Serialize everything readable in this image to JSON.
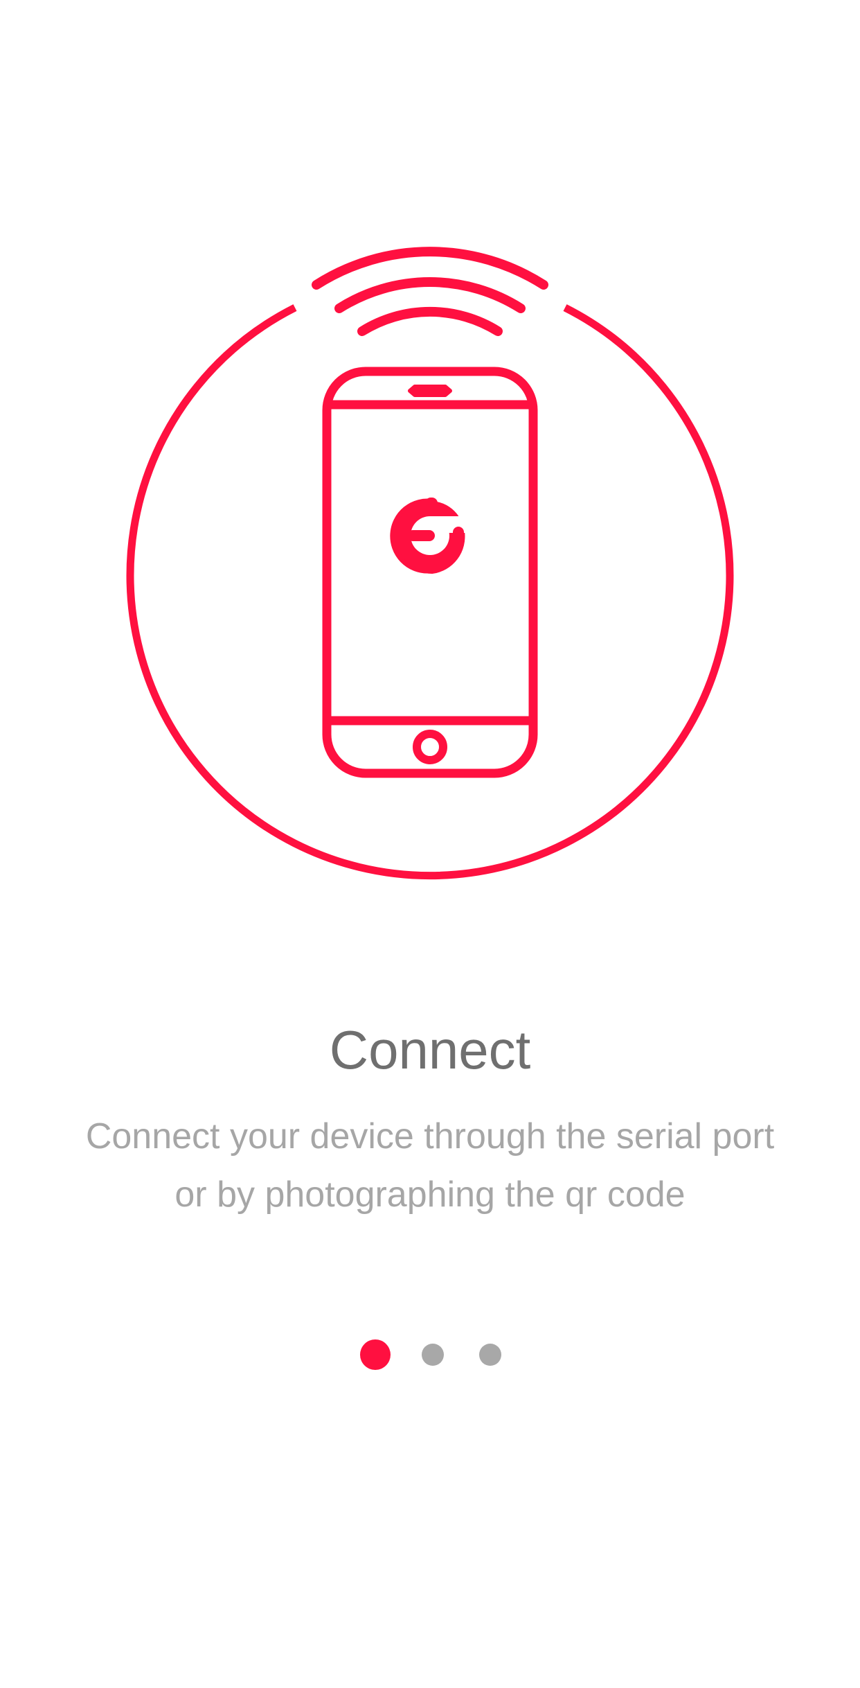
{
  "colors": {
    "accent": "#ff1040",
    "title": "#6f6f6f",
    "description": "#a6a6a6",
    "dot_inactive": "#a8a8a8",
    "background": "#ffffff"
  },
  "illustration": {
    "icons": [
      "circle-frame",
      "wifi-signal-icon",
      "smartphone-icon",
      "app-logo-icon"
    ]
  },
  "onboarding": {
    "title": "Connect",
    "description_line1": "Connect your device through the serial port",
    "description_line2": "or by photographing the qr code"
  },
  "pagination": {
    "total": 3,
    "active_index": 0
  }
}
